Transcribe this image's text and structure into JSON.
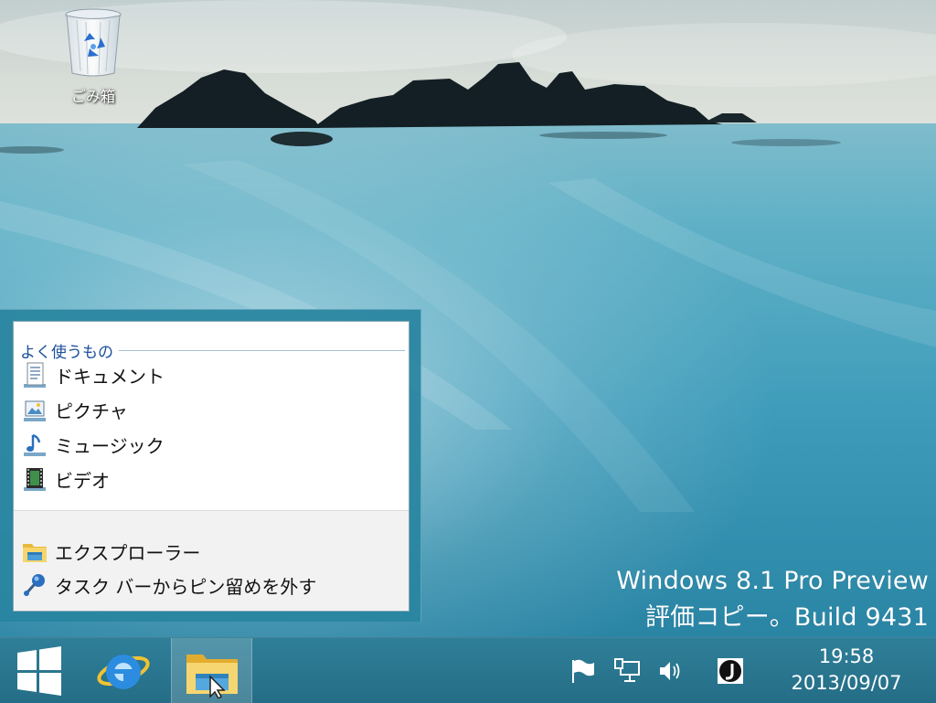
{
  "desktop": {
    "recycle_bin": {
      "label": "ごみ箱",
      "icon": "recycle-bin-icon"
    },
    "watermark": {
      "line1": "Windows 8.1 Pro Preview",
      "line2": "評価コピー。Build 9431"
    }
  },
  "jumplist": {
    "header": "よく使うもの",
    "pinned": [
      {
        "label": "ドキュメント",
        "icon": "documents-icon"
      },
      {
        "label": "ピクチャ",
        "icon": "pictures-icon"
      },
      {
        "label": "ミュージック",
        "icon": "music-icon"
      },
      {
        "label": "ビデオ",
        "icon": "videos-icon"
      }
    ],
    "tasks": [
      {
        "label": "エクスプローラー",
        "icon": "file-explorer-icon"
      },
      {
        "label": "タスク バーからピン留めを外す",
        "icon": "unpin-icon"
      }
    ]
  },
  "taskbar": {
    "buttons": [
      {
        "name": "start",
        "icon": "windows-logo-icon"
      },
      {
        "name": "internet-explorer",
        "icon": "internet-explorer-icon"
      },
      {
        "name": "file-explorer",
        "icon": "file-explorer-icon",
        "active": true
      }
    ],
    "tray": [
      {
        "name": "action-center",
        "icon": "flag-icon"
      },
      {
        "name": "network",
        "icon": "network-icon"
      },
      {
        "name": "volume",
        "icon": "speaker-icon"
      },
      {
        "name": "ime",
        "icon": "ime-j-icon"
      }
    ],
    "clock": {
      "time": "19:58",
      "date": "2013/09/07"
    }
  },
  "colors": {
    "taskbar": "#2a7590",
    "jumplist_frame": "#2884a0",
    "jumplist_header": "#1b4f9c",
    "sea": "#3a9ab8"
  }
}
